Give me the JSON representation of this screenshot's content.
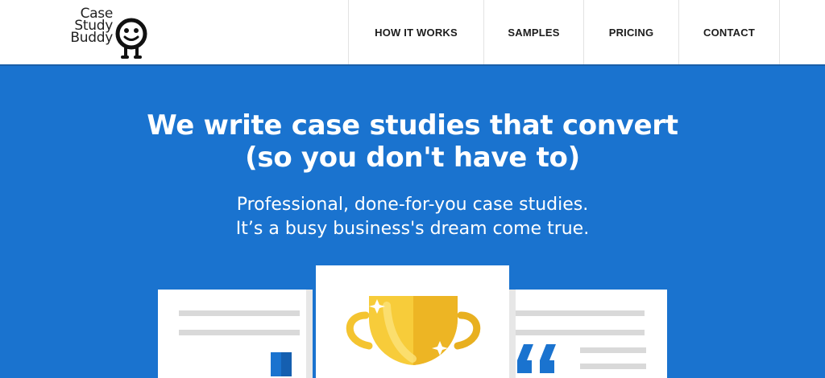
{
  "brand": {
    "logo_lines": [
      "Case",
      "Study",
      "Buddy"
    ]
  },
  "nav": {
    "items": [
      {
        "label": "HOW IT WORKS"
      },
      {
        "label": "SAMPLES"
      },
      {
        "label": "PRICING"
      },
      {
        "label": "CONTACT"
      }
    ]
  },
  "hero": {
    "title_lines": [
      "We write case studies that convert",
      "(so you don't have to)"
    ],
    "subtitle_lines": [
      "Professional, done-for-you case studies.",
      "It’s a busy business's dream come true."
    ]
  },
  "colors": {
    "hero_background": "#1a73cf",
    "header_background": "#ffffff",
    "trophy_gold": "#f4c430",
    "quote_blue": "#1a73cf"
  },
  "icons": [
    "logo-face-icon",
    "trophy-icon",
    "quote-icon",
    "bar-chart-icon"
  ]
}
